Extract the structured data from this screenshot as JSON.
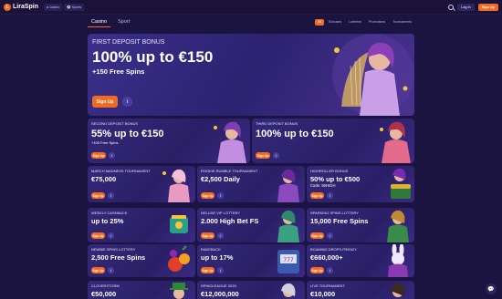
{
  "header": {
    "logo_letter": "L",
    "logo_text": "LiraSpin",
    "tabs": [
      {
        "label": "Casino",
        "icon": "casino-icon"
      },
      {
        "label": "Sports",
        "icon": "sports-icon"
      }
    ],
    "login_label": "Log In",
    "signup_label": "Sign Up"
  },
  "categories": {
    "tabs": [
      "Casino",
      "Sport"
    ],
    "active": "Casino",
    "filters": [
      "All",
      "Bonuses",
      "Lotteries",
      "Promotions",
      "Tournaments"
    ],
    "active_filter": "All"
  },
  "hero": {
    "subtitle": "FIRST DEPOSIT BONUS",
    "title": "100% up to €150",
    "extra": "+150 Free Spins",
    "button": "Sign Up",
    "info": "i"
  },
  "row1": [
    {
      "subtitle": "SECOND DEPOSIT BONUS",
      "title": "55% up to €150",
      "extra": "+100 Free Spins",
      "button": "Sign Up",
      "info": "i"
    },
    {
      "subtitle": "THIRD DEPOSIT BONUS",
      "title": "100% up to €150",
      "extra": "",
      "button": "Sign Up",
      "info": "i"
    }
  ],
  "grid": [
    {
      "subtitle": "MARCH MADNESS TOURNAMENT",
      "title": "€75,000",
      "extra": "",
      "button": "Sign Up",
      "info": "i"
    },
    {
      "subtitle": "ROOKIE RUMBLE TOURNAMENT",
      "title": "€2,500 Daily",
      "extra": "",
      "button": "Sign Up",
      "info": "i"
    },
    {
      "subtitle": "HIGHROLLER BONUS",
      "title": "50% up to €500",
      "extra": "Code: 50HIGH",
      "button": "Sign Up",
      "info": "i"
    },
    {
      "subtitle": "WEEKLY CASHBACK",
      "title": "up to 25%",
      "extra": "",
      "button": "Sign Up",
      "info": "i"
    },
    {
      "subtitle": "DELUXE VIP LOTTERY",
      "title": "2.000 High Bet FS",
      "extra": "",
      "button": "Sign Up",
      "info": "i"
    },
    {
      "subtitle": "SPARKING SPINS LOTTERY",
      "title": "15,000 Free Spins",
      "extra": "",
      "button": "Sign Up",
      "info": "i"
    },
    {
      "subtitle": "NEWBIE SPINS LOTTERY",
      "title": "2,500 Free Spins",
      "extra": "",
      "button": "Sign Up",
      "info": "i"
    },
    {
      "subtitle": "RAKEBACK",
      "title": "up to 17%",
      "extra": "",
      "button": "Sign Up",
      "info": "i"
    },
    {
      "subtitle": "BCAMING DROPS FRENZY",
      "title": "€660,000+",
      "extra": "",
      "button": "Sign Up",
      "info": "i"
    },
    {
      "subtitle": "CLOVERSTORM",
      "title": "€50,000",
      "extra": "",
      "button": "Sign Up",
      "info": "i"
    },
    {
      "subtitle": "SPINOLEAGUE 2025",
      "title": "€12,000,000",
      "extra": "",
      "button": "Sign Up",
      "info": "i"
    },
    {
      "subtitle": "LIVE TOURNAMENT",
      "title": "€10,000",
      "extra": "",
      "button": "Sign Up",
      "info": "i"
    }
  ],
  "colors": {
    "accent": "#f06a1f",
    "background": "#1c1440",
    "card": "#2f2570"
  }
}
